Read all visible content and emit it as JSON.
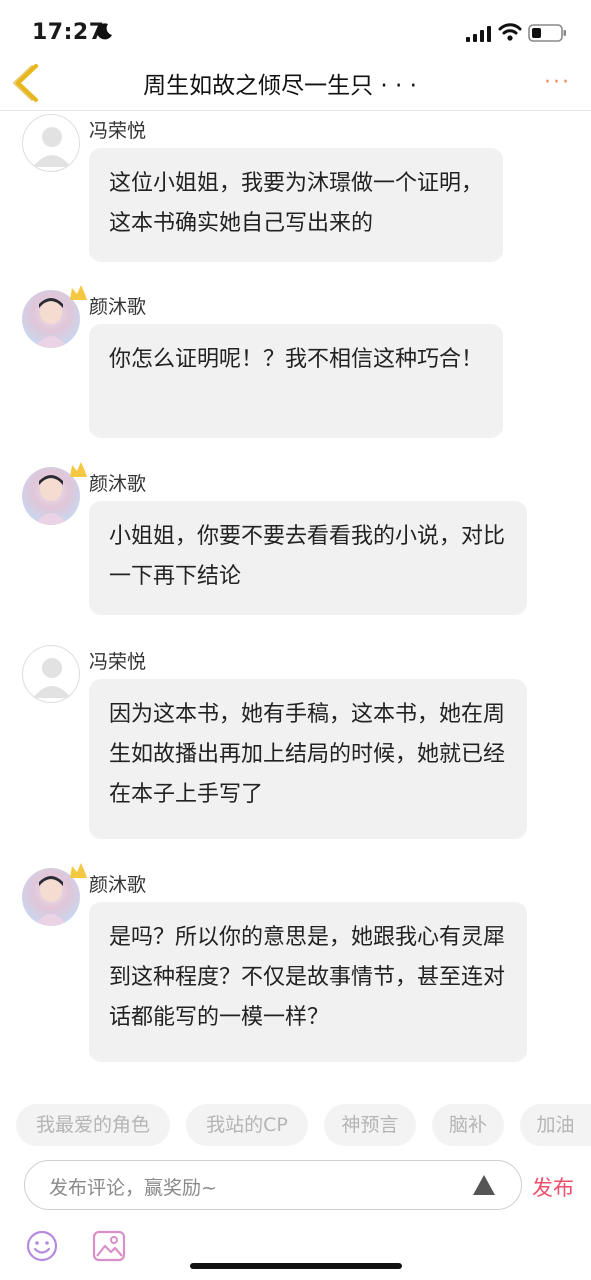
{
  "status_bar": {
    "time": "17:27"
  },
  "nav": {
    "title": "周生如故之倾尽一生只 · · ·",
    "more": "···"
  },
  "messages": [
    {
      "user": "冯荣悦",
      "avatar": "gray-placeholder-avatar",
      "text": "这位小姐姐，我要为沐璟做一个证明，这本书确实她自己写出来的"
    },
    {
      "user": "颜沐歌",
      "avatar": "photo-avatar",
      "crown": true,
      "text": "你怎么证明呢！？我不相信这种巧合！"
    },
    {
      "user": "颜沐歌",
      "avatar": "photo-avatar",
      "crown": true,
      "text": "小姐姐，你要不要去看看我的小说，对比一下再下结论"
    },
    {
      "user": "冯荣悦",
      "avatar": "gray-placeholder-avatar",
      "text": "因为这本书，她有手稿，这本书，她在周生如故播出再加上结局的时候，她就已经在本子上手写了"
    },
    {
      "user": "颜沐歌",
      "avatar": "photo-avatar",
      "crown": true,
      "text": "是吗？所以你的意思是，她跟我心有灵犀到这种程度？不仅是故事情节，甚至连对话都能写的一模一样？"
    }
  ],
  "tags": [
    "我最爱的角色",
    "我站的CP",
    "神预言",
    "脑补",
    "加油"
  ],
  "composer": {
    "placeholder": "发布评论，赢奖励~",
    "send_label": "发布"
  },
  "colors": {
    "accent": "#f04f6a",
    "back_icon": "#e8b71a",
    "more": "#f08a62",
    "emoji_icon": "#b48be0",
    "image_icon": "#d98fc8"
  },
  "icons": [
    "back-arrow-icon",
    "more-icon",
    "crown-icon",
    "send-triangle-icon",
    "emoji-icon",
    "image-icon"
  ]
}
